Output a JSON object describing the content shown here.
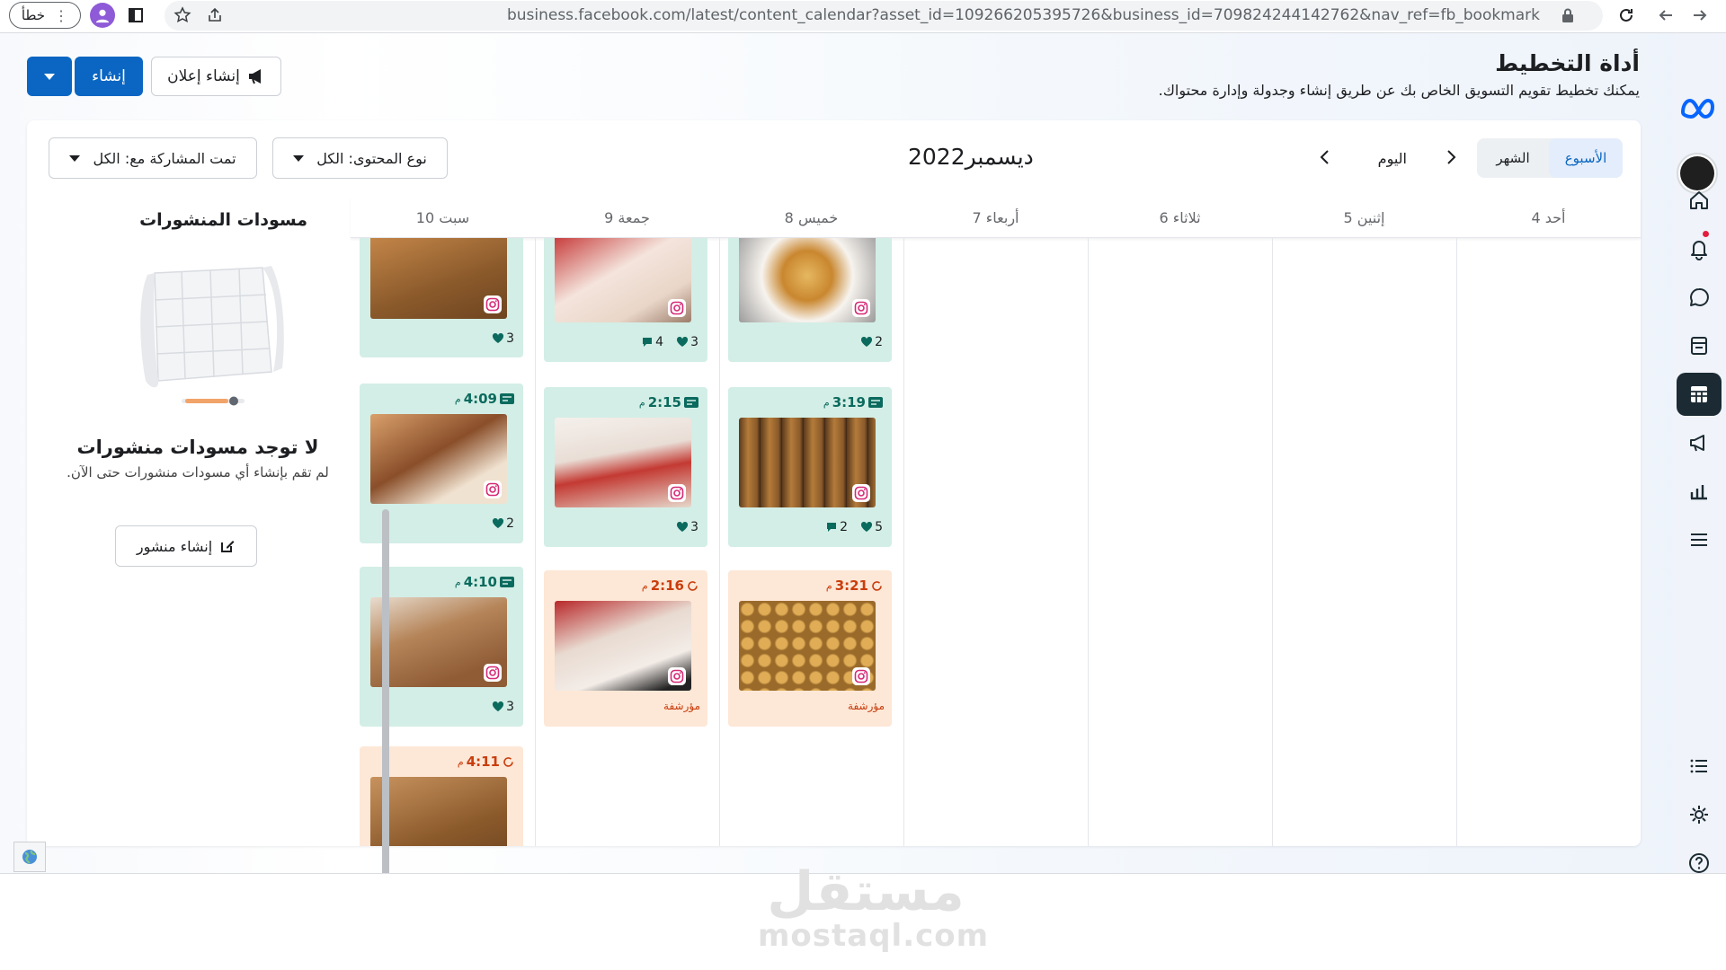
{
  "browser": {
    "error_label": "خطأ",
    "url": "business.facebook.com/latest/content_calendar?asset_id=109266205395726&business_id=709824244142762&nav_ref=fb_bookmark"
  },
  "header": {
    "title": "أداة التخطيط",
    "subtitle": "يمكنك تخطيط تقويم التسويق الخاص بك عن طريق إنشاء وجدولة وإدارة محتواك.",
    "create_label": "إنشاء",
    "create_ad_label": "إنشاء إعلان"
  },
  "toolbar": {
    "week_label": "الأسبوع",
    "month_label": "الشهر",
    "today_label": "اليوم",
    "month_title": "ديسمبر2022",
    "content_type_filter": "نوع المحتوى: الكل",
    "shared_filter": "تمت المشاركة مع: الكل"
  },
  "days": [
    "أحد 4",
    "إثنين 5",
    "ثلاثاء 6",
    "أربعاء 7",
    "خميس 8",
    "جمعة 9",
    "سبت 10"
  ],
  "posts": {
    "thu_top": {
      "likes": "2"
    },
    "fri_top": {
      "likes": "3",
      "comments": "4"
    },
    "sat_top": {
      "likes": "3"
    },
    "thu_mid": {
      "time": "3:19",
      "suffix": "م",
      "likes": "5",
      "comments": "2"
    },
    "fri_mid": {
      "time": "2:15",
      "suffix": "م",
      "likes": "3"
    },
    "sat_mid": {
      "time": "4:09",
      "suffix": "م",
      "likes": "2"
    },
    "thu_draft": {
      "time": "3:21",
      "suffix": "م",
      "status": "مؤرشفة"
    },
    "fri_draft": {
      "time": "2:16",
      "suffix": "م",
      "status": "مؤرشفة"
    },
    "sat_low": {
      "time": "4:10",
      "suffix": "م",
      "likes": "3"
    },
    "sat_last": {
      "time": "4:11",
      "suffix": "م"
    }
  },
  "drafts": {
    "title": "مسودات المنشورات",
    "empty_title": "لا توجد مسودات منشورات",
    "empty_sub": "لم تقم بإنشاء أي مسودات منشورات حتى الآن.",
    "create_post_label": "إنشاء منشور"
  },
  "watermark": {
    "arabic": "مستقل",
    "latin": "mostaql.com"
  },
  "colors": {
    "accent": "#0a66c2",
    "published": "#d3eee6",
    "archived": "#fde7d6",
    "published_text": "#0b6a5e",
    "archived_text": "#c93d0d"
  }
}
